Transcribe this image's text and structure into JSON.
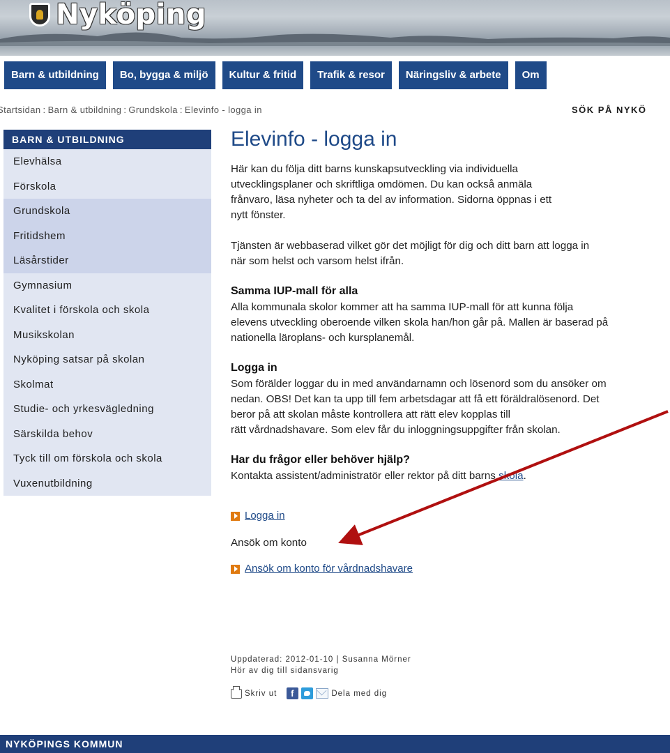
{
  "header": {
    "site_name": "Nyköping",
    "logo_icon": "municipal-crest-icon"
  },
  "topnav": [
    {
      "label": "Barn & utbildning"
    },
    {
      "label": "Bo, bygga & miljö"
    },
    {
      "label": "Kultur & fritid"
    },
    {
      "label": "Trafik & resor"
    },
    {
      "label": "Näringsliv & arbete"
    },
    {
      "label": "Om"
    }
  ],
  "breadcrumb": {
    "items": [
      "Startsidan",
      "Barn & utbildning",
      "Grundskola",
      "Elevinfo - logga in"
    ],
    "separator": ":"
  },
  "search": {
    "label": "SÖK PÅ NYKÖ"
  },
  "sidebar": {
    "title": "BARN & UTBILDNING",
    "items": [
      {
        "label": "Elevhälsa"
      },
      {
        "label": "Förskola"
      },
      {
        "label": "Grundskola"
      },
      {
        "label": "Fritidshem"
      },
      {
        "label": "Läsårstider"
      },
      {
        "label": "Gymnasium"
      },
      {
        "label": "Kvalitet i förskola och skola"
      },
      {
        "label": "Musikskolan"
      },
      {
        "label": "Nyköping satsar på skolan"
      },
      {
        "label": "Skolmat"
      },
      {
        "label": "Studie- och yrkesvägledning"
      },
      {
        "label": "Särskilda behov"
      },
      {
        "label": "Tyck till om förskola och skola"
      },
      {
        "label": "Vuxenutbildning"
      }
    ]
  },
  "main": {
    "title": "Elevinfo - logga in",
    "intro_lines": [
      "Här kan du följa ditt barns kunskapsutveckling via individuella",
      "utvecklingsplaner och skriftliga omdömen. Du kan också anmäla",
      "frånvaro, läsa nyheter och ta del av information. Sidorna öppnas i ett",
      "nytt fönster."
    ],
    "service_lines": [
      "Tjänsten är webbaserad vilket gör det möjligt för dig och ditt barn att logga in",
      "när som helst och varsom helst ifrån."
    ],
    "iup": {
      "heading": "Samma IUP-mall för alla",
      "lines": [
        "Alla kommunala skolor kommer att ha samma IUP-mall för att kunna följa",
        "elevens utveckling oberoende vilken skola han/hon går på. Mallen är baserad på",
        "nationella läroplans- och kursplanemål."
      ]
    },
    "login": {
      "heading": "Logga in",
      "lines": [
        "Som förälder loggar du in med användarnamn och lösenord som du ansöker om",
        "nedan. OBS! Det kan ta upp till fem arbetsdagar att få ett föräldralösenord. Det",
        "beror på att skolan måste kontrollera att rätt elev kopplas till",
        "rätt vårdnadshavare. Som elev får du inloggningsuppgifter från skolan."
      ]
    },
    "help": {
      "heading": "Har du frågor eller behöver hjälp?",
      "text": "Kontakta assistent/administratör eller rektor på ditt barns ",
      "link": "skola",
      "end": "."
    },
    "login_link": "Logga in",
    "apply_heading": "Ansök om konto",
    "apply_link": "Ansök om konto för vårdnadshavare",
    "updated": "Uppdaterad: 2012-01-10 | Susanna Mörner",
    "contact": "Hör av dig till sidansvarig",
    "print_label": "Skriv ut",
    "share_label": "Dela med dig"
  },
  "footer": {
    "title": "NYKÖPINGS KOMMUN"
  },
  "colors": {
    "nav_blue": "#1f4a88",
    "sidebar_head": "#1f3f79",
    "sidebar_bg": "#e1e6f2",
    "sidebar_active": "#ccd4ea",
    "link_orange": "#e07a10",
    "annotation_red": "#b01010"
  }
}
